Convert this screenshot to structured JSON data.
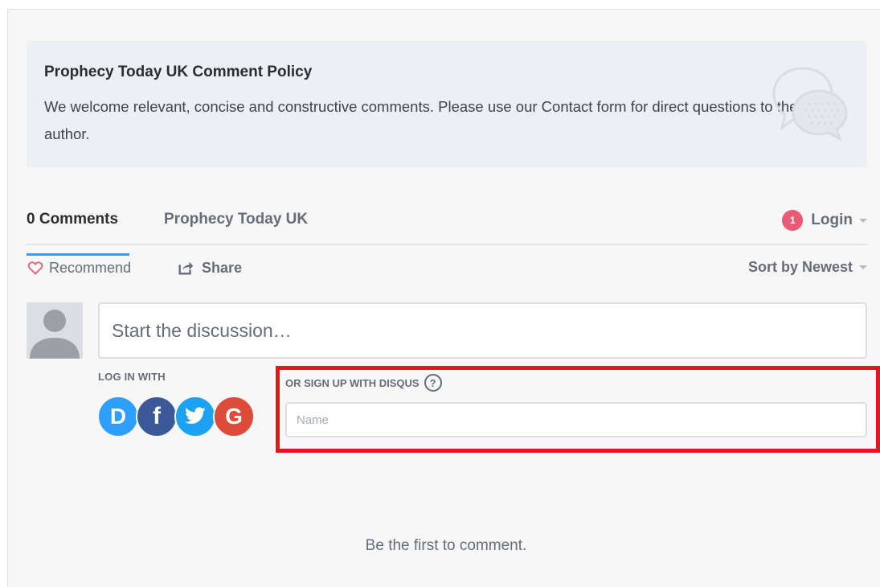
{
  "policy": {
    "title": "Prophecy Today UK Comment Policy",
    "text": "We welcome relevant, concise and constructive comments. Please use our Contact form for direct questions to the author.",
    "icon": "speech-bubbles-icon"
  },
  "tabs": {
    "comments_label": "0 Comments",
    "forum_label": "Prophecy Today UK",
    "login_badge": "1",
    "login_label": "Login"
  },
  "actions": {
    "recommend_label": "Recommend",
    "share_label": "Share",
    "sort_label": "Sort by Newest"
  },
  "composer": {
    "placeholder": "Start the discussion…",
    "login_with_label": "LOG IN WITH",
    "social_providers": [
      {
        "name": "Disqus",
        "glyph": "D",
        "color": "#2e9fff"
      },
      {
        "name": "Facebook",
        "glyph": "f",
        "color": "#3b5998"
      },
      {
        "name": "Twitter",
        "glyph": "twitter-bird-icon",
        "color": "#1da1f2"
      },
      {
        "name": "Google",
        "glyph": "G",
        "color": "#dd4b39"
      }
    ],
    "signup_label": "OR SIGN UP WITH DISQUS",
    "help_glyph": "?",
    "name_placeholder": "Name"
  },
  "empty_state": "Be the first to comment.",
  "colors": {
    "accent": "#2e9fff",
    "badge": "#e85d75",
    "highlight": "#e3161e",
    "recommend_heart": "#e85d75"
  }
}
